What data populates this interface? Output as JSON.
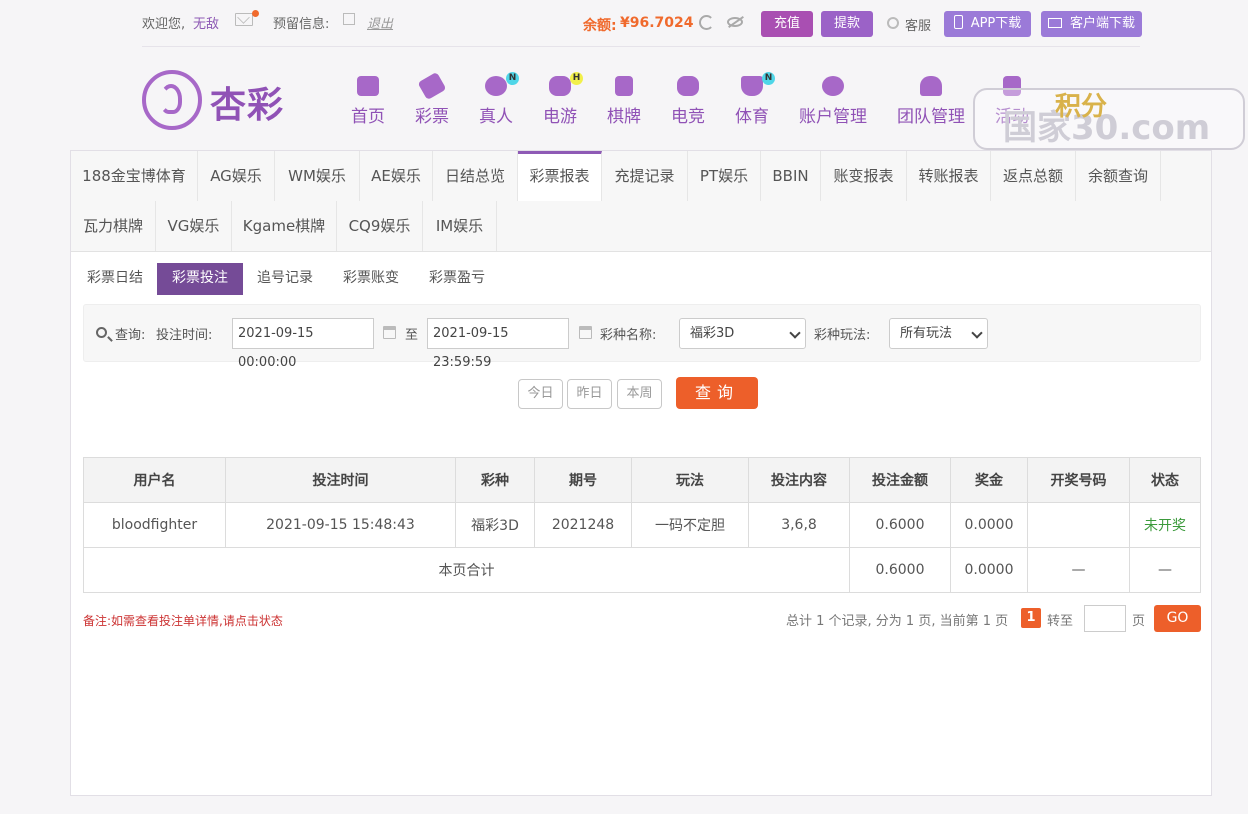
{
  "topbar": {
    "welcome": "欢迎您,",
    "username": "无敌",
    "reserved_info": "预留信息:",
    "logout": "退出",
    "balance_label": "余额:",
    "balance_value": "¥96.7024",
    "recharge": "充值",
    "withdraw": "提款",
    "customer_service": "客服",
    "app_download": "APP下载",
    "client_download": "客户端下载"
  },
  "brand": {
    "logo_text": "杏彩"
  },
  "nav": {
    "items": [
      {
        "label": "首页",
        "icon": "home-icon"
      },
      {
        "label": "彩票",
        "icon": "ticket-icon"
      },
      {
        "label": "真人",
        "icon": "live-dealer-icon",
        "badge": "N"
      },
      {
        "label": "电游",
        "icon": "gamepad-icon",
        "badge": "H"
      },
      {
        "label": "棋牌",
        "icon": "cards-icon"
      },
      {
        "label": "电竞",
        "icon": "esports-icon"
      },
      {
        "label": "体育",
        "icon": "trophy-icon",
        "badge": "N"
      },
      {
        "label": "账户管理",
        "icon": "yen-icon"
      },
      {
        "label": "团队管理",
        "icon": "team-icon"
      },
      {
        "label": "活动",
        "icon": "gift-icon"
      }
    ]
  },
  "watermark": {
    "text": "国家30.com",
    "extra": "积分"
  },
  "report_tabs": [
    "188金宝博体育",
    "AG娱乐",
    "WM娱乐",
    "AE娱乐",
    "日结总览",
    "彩票报表",
    "充提记录",
    "PT娱乐",
    "BBIN",
    "账变报表",
    "转账报表",
    "返点总额",
    "余额查询",
    "瓦力棋牌",
    "VG娱乐",
    "Kgame棋牌",
    "CQ9娱乐",
    "IM娱乐"
  ],
  "active_report_tab": "彩票报表",
  "sub_tabs": [
    "彩票日结",
    "彩票投注",
    "追号记录",
    "彩票账变",
    "彩票盈亏"
  ],
  "active_sub_tab": "彩票投注",
  "filter": {
    "query_label": "查询:",
    "bet_time_label": "投注时间:",
    "start_time": "2021-09-15 00:00:00",
    "to": "至",
    "end_time": "2021-09-15 23:59:59",
    "lottery_name_label": "彩种名称:",
    "lottery_selected": "福彩3D",
    "play_label": "彩种玩法:",
    "play_selected": "所有玩法",
    "today": "今日",
    "yesterday": "昨日",
    "this_week": "本周",
    "query_button": "查询"
  },
  "table": {
    "headers": [
      "用户名",
      "投注时间",
      "彩种",
      "期号",
      "玩法",
      "投注内容",
      "投注金额",
      "奖金",
      "开奖号码",
      "状态"
    ],
    "rows": [
      {
        "username": "bloodfighter",
        "bet_time": "2021-09-15 15:48:43",
        "lottery": "福彩3D",
        "issue": "2021248",
        "play": "一码不定胆",
        "content": "3,6,8",
        "amount": "0.6000",
        "prize": "0.0000",
        "draw_number": "",
        "status": "未开奖"
      }
    ],
    "subtotal": {
      "label": "本页合计",
      "amount": "0.6000",
      "prize": "0.0000",
      "draw_number": "—",
      "status": "—"
    }
  },
  "remark": "备注:如需查看投注单详情,请点击状态",
  "pagination": {
    "summary": "总计 1 个记录, 分为 1 页, 当前第 1 页",
    "current_page": "1",
    "goto_label": "转至",
    "page_unit": "页",
    "go": "GO"
  }
}
